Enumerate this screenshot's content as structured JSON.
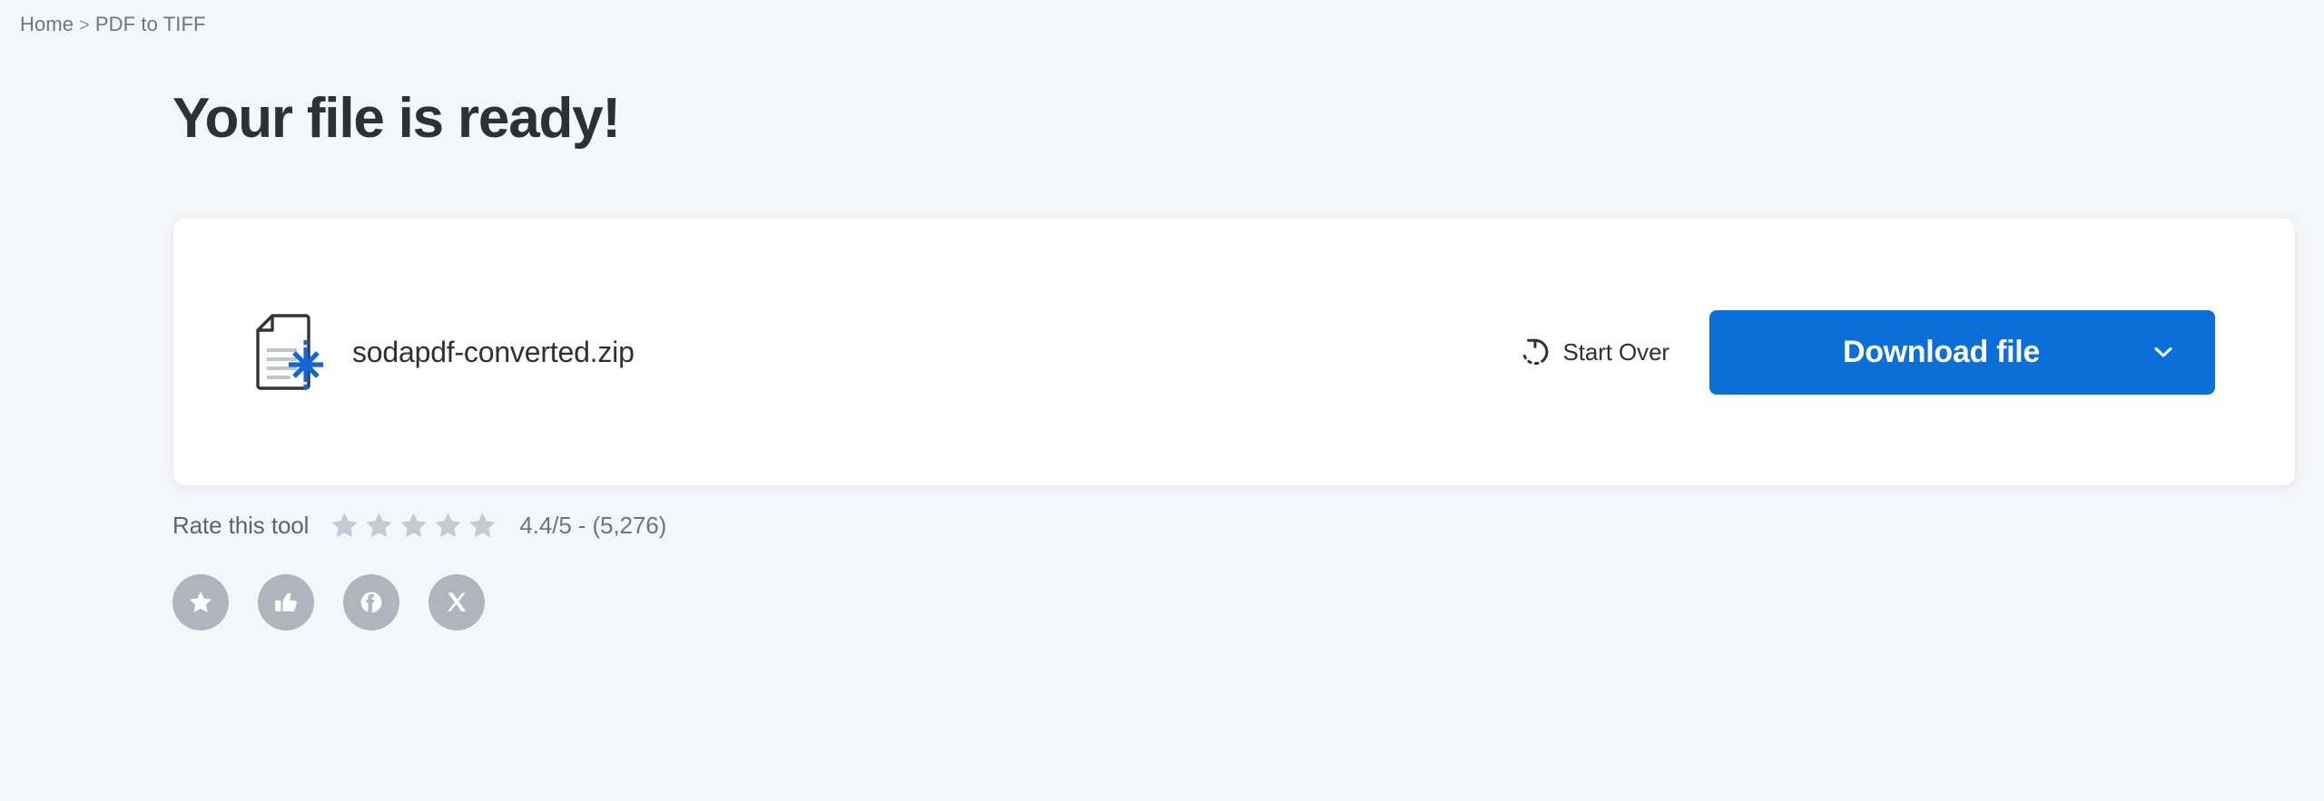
{
  "breadcrumb": {
    "home_label": "Home",
    "separator": ">",
    "current_label": "PDF to TIFF"
  },
  "heading": {
    "title": "Your file is ready!"
  },
  "file_card": {
    "file_icon_name": "converted-file-icon",
    "file_name": "sodapdf-converted.zip",
    "start_over": {
      "icon_name": "rotate-left-icon",
      "label": "Start Over"
    },
    "download": {
      "label": "Download file",
      "chevron_icon_name": "chevron-down-icon",
      "color": "#0a6fd8"
    }
  },
  "rating": {
    "label": "Rate this tool",
    "stars_total": 5,
    "stars_filled": 5,
    "star_color": "#c4c9d4",
    "score_text": "4.4/5 - (5,276)"
  },
  "social": {
    "buttons": [
      {
        "name": "favorite-star-button",
        "icon": "star-icon"
      },
      {
        "name": "thumbs-up-button",
        "icon": "thumbs-up-icon"
      },
      {
        "name": "facebook-share-button",
        "icon": "facebook-icon"
      },
      {
        "name": "x-share-button",
        "icon": "x-twitter-icon"
      }
    ],
    "circle_color": "#b0b4bd"
  },
  "theme": {
    "page_background": "#f5f6fa",
    "card_background": "#ffffff",
    "text_primary": "#2e3033",
    "text_muted": "#70747c",
    "accent": "#0a6fd8"
  }
}
